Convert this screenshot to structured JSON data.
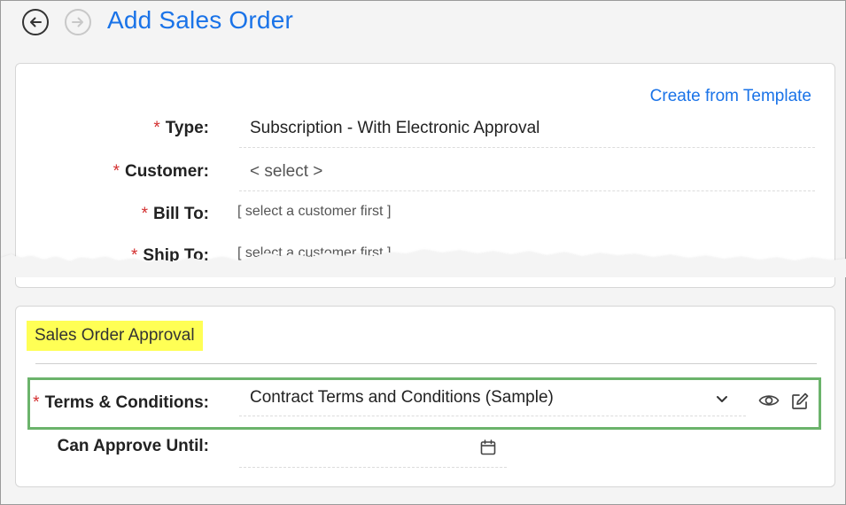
{
  "header": {
    "title": "Add Sales Order",
    "back_icon": "arrow-left-circle-icon",
    "forward_icon": "arrow-right-circle-icon"
  },
  "main_form": {
    "template_link": "Create from Template",
    "required_marker": "*",
    "fields": [
      {
        "label": "Type:",
        "required": true,
        "value": "Subscription - With Electronic Approval"
      },
      {
        "label": "Customer:",
        "required": true,
        "value": "< select >"
      },
      {
        "label": "Bill To:",
        "required": true,
        "value": "[ select a customer first ]"
      },
      {
        "label": "Ship To:",
        "required": true,
        "value": "[ select a customer first ]"
      }
    ]
  },
  "approval": {
    "heading": "Sales Order Approval",
    "terms": {
      "label": "Terms & Conditions:",
      "required": true,
      "value": "Contract Terms and Conditions (Sample)",
      "icons": [
        "chevron-down-icon",
        "eye-icon",
        "edit-icon"
      ]
    },
    "approve_until": {
      "label": "Can Approve Until:",
      "value": "",
      "icon": "calendar-icon"
    }
  },
  "colors": {
    "accent": "#1a73e8",
    "required": "#d32f2f",
    "highlight_fill": "#ffff55",
    "highlight_border": "#6bb36b"
  }
}
